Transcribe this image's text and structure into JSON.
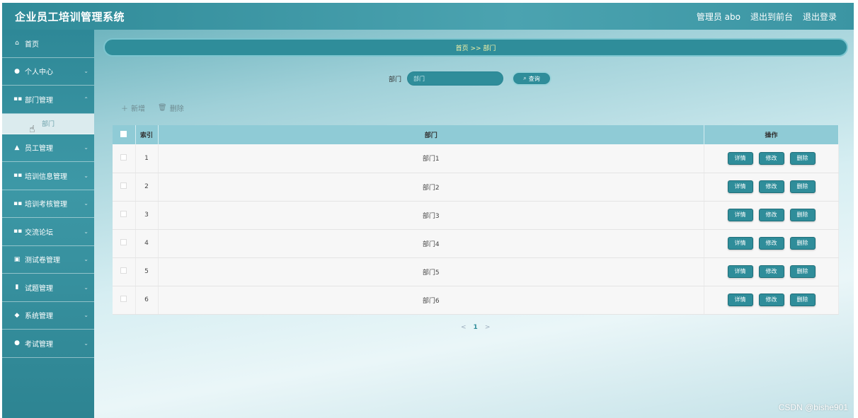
{
  "header": {
    "title": "企业员工培训管理系统",
    "admin_label": "管理员 abo",
    "to_front": "退出到前台",
    "logout": "退出登录"
  },
  "sidebar": {
    "items": [
      {
        "icon": "home-icon",
        "label": "首页",
        "has_chevron": false
      },
      {
        "icon": "user-icon",
        "label": "个人中心",
        "has_chevron": true
      },
      {
        "icon": "grid-icon",
        "label": "部门管理",
        "has_chevron": true
      },
      {
        "icon": "employee-icon",
        "label": "员工管理",
        "has_chevron": true
      },
      {
        "icon": "grid-icon",
        "label": "培训信息管理",
        "has_chevron": true
      },
      {
        "icon": "grid-icon",
        "label": "培训考核管理",
        "has_chevron": true
      },
      {
        "icon": "grid-icon",
        "label": "交流论坛",
        "has_chevron": true
      },
      {
        "icon": "book-icon",
        "label": "测试卷管理",
        "has_chevron": true
      },
      {
        "icon": "bar-chart-icon",
        "label": "试题管理",
        "has_chevron": true
      },
      {
        "icon": "settings-icon",
        "label": "系统管理",
        "has_chevron": true
      },
      {
        "icon": "pin-icon",
        "label": "考试管理",
        "has_chevron": true
      }
    ],
    "submenu": {
      "label": "部门"
    }
  },
  "breadcrumb": {
    "text": "首页 >> 部门"
  },
  "search": {
    "label": "部门",
    "placeholder": "部门",
    "button": "查询"
  },
  "toolbar": {
    "add": "新增",
    "delete": "删除"
  },
  "table": {
    "headers": {
      "index": "索引",
      "name": "部门",
      "ops": "操作"
    },
    "rows": [
      {
        "index": "1",
        "name": "部门1"
      },
      {
        "index": "2",
        "name": "部门2"
      },
      {
        "index": "3",
        "name": "部门3"
      },
      {
        "index": "4",
        "name": "部门4"
      },
      {
        "index": "5",
        "name": "部门5"
      },
      {
        "index": "6",
        "name": "部门6"
      }
    ],
    "ops": {
      "detail": "详情",
      "edit": "修改",
      "delete": "删除"
    }
  },
  "pagination": {
    "prev": "<",
    "current": "1",
    "next": ">"
  },
  "watermark": "CSDN @bishe901",
  "colors": {
    "primary": "#2f8d9a",
    "header_th": "#8fcbd6",
    "breadcrumb_text": "#f6f3a6"
  }
}
